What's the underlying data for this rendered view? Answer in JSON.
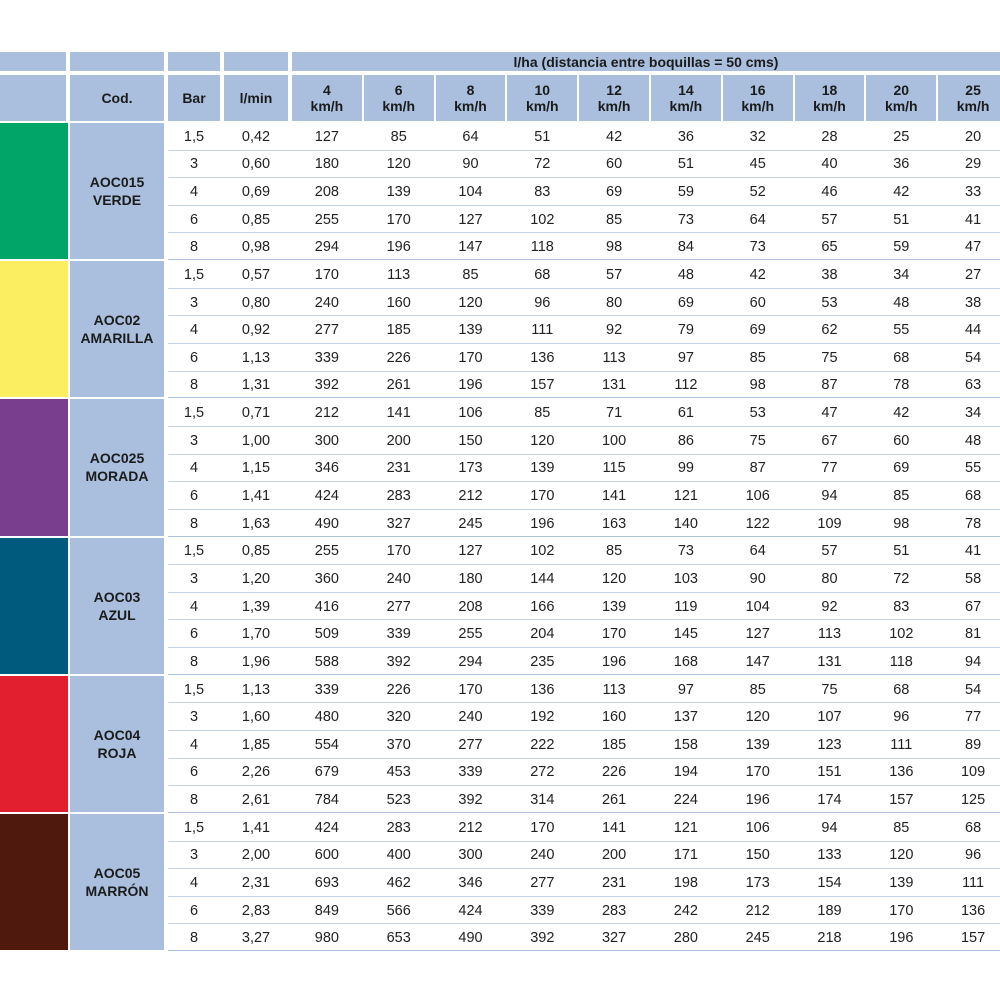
{
  "header": {
    "title": "l/ha (distancia entre boquillas = 50 cms)",
    "cod": "Cod.",
    "bar": "Bar",
    "lmin": "l/min",
    "speeds": [
      {
        "num": "4",
        "unit": "km/h"
      },
      {
        "num": "6",
        "unit": "km/h"
      },
      {
        "num": "8",
        "unit": "km/h"
      },
      {
        "num": "10",
        "unit": "km/h"
      },
      {
        "num": "12",
        "unit": "km/h"
      },
      {
        "num": "14",
        "unit": "km/h"
      },
      {
        "num": "16",
        "unit": "km/h"
      },
      {
        "num": "18",
        "unit": "km/h"
      },
      {
        "num": "20",
        "unit": "km/h"
      },
      {
        "num": "25",
        "unit": "km/h"
      }
    ]
  },
  "groups": [
    {
      "code": "AOC015",
      "name": "VERDE",
      "color": "#00a567",
      "rows": [
        [
          "1,5",
          "0,42",
          "127",
          "85",
          "64",
          "51",
          "42",
          "36",
          "32",
          "28",
          "25",
          "20"
        ],
        [
          "3",
          "0,60",
          "180",
          "120",
          "90",
          "72",
          "60",
          "51",
          "45",
          "40",
          "36",
          "29"
        ],
        [
          "4",
          "0,69",
          "208",
          "139",
          "104",
          "83",
          "69",
          "59",
          "52",
          "46",
          "42",
          "33"
        ],
        [
          "6",
          "0,85",
          "255",
          "170",
          "127",
          "102",
          "85",
          "73",
          "64",
          "57",
          "51",
          "41"
        ],
        [
          "8",
          "0,98",
          "294",
          "196",
          "147",
          "118",
          "98",
          "84",
          "73",
          "65",
          "59",
          "47"
        ]
      ]
    },
    {
      "code": "AOC02",
      "name": "AMARILLA",
      "color": "#fbee60",
      "rows": [
        [
          "1,5",
          "0,57",
          "170",
          "113",
          "85",
          "68",
          "57",
          "48",
          "42",
          "38",
          "34",
          "27"
        ],
        [
          "3",
          "0,80",
          "240",
          "160",
          "120",
          "96",
          "80",
          "69",
          "60",
          "53",
          "48",
          "38"
        ],
        [
          "4",
          "0,92",
          "277",
          "185",
          "139",
          "111",
          "92",
          "79",
          "69",
          "62",
          "55",
          "44"
        ],
        [
          "6",
          "1,13",
          "339",
          "226",
          "170",
          "136",
          "113",
          "97",
          "85",
          "75",
          "68",
          "54"
        ],
        [
          "8",
          "1,31",
          "392",
          "261",
          "196",
          "157",
          "131",
          "112",
          "98",
          "87",
          "78",
          "63"
        ]
      ]
    },
    {
      "code": "AOC025",
      "name": "MORADA",
      "color": "#7a3e8e",
      "rows": [
        [
          "1,5",
          "0,71",
          "212",
          "141",
          "106",
          "85",
          "71",
          "61",
          "53",
          "47",
          "42",
          "34"
        ],
        [
          "3",
          "1,00",
          "300",
          "200",
          "150",
          "120",
          "100",
          "86",
          "75",
          "67",
          "60",
          "48"
        ],
        [
          "4",
          "1,15",
          "346",
          "231",
          "173",
          "139",
          "115",
          "99",
          "87",
          "77",
          "69",
          "55"
        ],
        [
          "6",
          "1,41",
          "424",
          "283",
          "212",
          "170",
          "141",
          "121",
          "106",
          "94",
          "85",
          "68"
        ],
        [
          "8",
          "1,63",
          "490",
          "327",
          "245",
          "196",
          "163",
          "140",
          "122",
          "109",
          "98",
          "78"
        ]
      ]
    },
    {
      "code": "AOC03",
      "name": "AZUL",
      "color": "#005a7e",
      "rows": [
        [
          "1,5",
          "0,85",
          "255",
          "170",
          "127",
          "102",
          "85",
          "73",
          "64",
          "57",
          "51",
          "41"
        ],
        [
          "3",
          "1,20",
          "360",
          "240",
          "180",
          "144",
          "120",
          "103",
          "90",
          "80",
          "72",
          "58"
        ],
        [
          "4",
          "1,39",
          "416",
          "277",
          "208",
          "166",
          "139",
          "119",
          "104",
          "92",
          "83",
          "67"
        ],
        [
          "6",
          "1,70",
          "509",
          "339",
          "255",
          "204",
          "170",
          "145",
          "127",
          "113",
          "102",
          "81"
        ],
        [
          "8",
          "1,96",
          "588",
          "392",
          "294",
          "235",
          "196",
          "168",
          "147",
          "131",
          "118",
          "94"
        ]
      ]
    },
    {
      "code": "AOC04",
      "name": "ROJA",
      "color": "#e21f2e",
      "rows": [
        [
          "1,5",
          "1,13",
          "339",
          "226",
          "170",
          "136",
          "113",
          "97",
          "85",
          "75",
          "68",
          "54"
        ],
        [
          "3",
          "1,60",
          "480",
          "320",
          "240",
          "192",
          "160",
          "137",
          "120",
          "107",
          "96",
          "77"
        ],
        [
          "4",
          "1,85",
          "554",
          "370",
          "277",
          "222",
          "185",
          "158",
          "139",
          "123",
          "111",
          "89"
        ],
        [
          "6",
          "2,26",
          "679",
          "453",
          "339",
          "272",
          "226",
          "194",
          "170",
          "151",
          "136",
          "109"
        ],
        [
          "8",
          "2,61",
          "784",
          "523",
          "392",
          "314",
          "261",
          "224",
          "196",
          "174",
          "157",
          "125"
        ]
      ]
    },
    {
      "code": "AOC05",
      "name": "MARRÓN",
      "color": "#4f1a0d",
      "rows": [
        [
          "1,5",
          "1,41",
          "424",
          "283",
          "212",
          "170",
          "141",
          "121",
          "106",
          "94",
          "85",
          "68"
        ],
        [
          "3",
          "2,00",
          "600",
          "400",
          "300",
          "240",
          "200",
          "171",
          "150",
          "133",
          "120",
          "96"
        ],
        [
          "4",
          "2,31",
          "693",
          "462",
          "346",
          "277",
          "231",
          "198",
          "173",
          "154",
          "139",
          "111"
        ],
        [
          "6",
          "2,83",
          "849",
          "566",
          "424",
          "339",
          "283",
          "242",
          "212",
          "189",
          "170",
          "136"
        ],
        [
          "8",
          "3,27",
          "980",
          "653",
          "490",
          "392",
          "327",
          "280",
          "245",
          "218",
          "196",
          "157"
        ]
      ]
    }
  ]
}
